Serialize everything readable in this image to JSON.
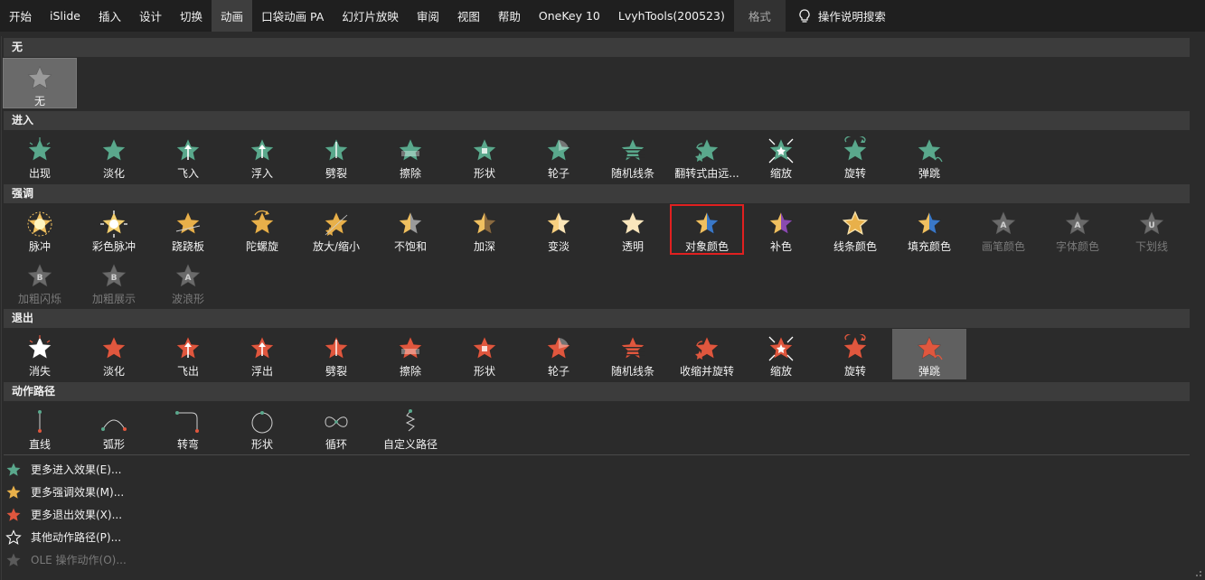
{
  "ribbon": {
    "tabs": [
      "开始",
      "iSlide",
      "插入",
      "设计",
      "切换",
      "动画",
      "口袋动画 PA",
      "幻灯片放映",
      "审阅",
      "视图",
      "帮助",
      "OneKey 10",
      "LvyhTools(200523)"
    ],
    "format_tab": "格式",
    "search_label": "操作说明搜索"
  },
  "sections": {
    "none": "无",
    "entrance": "进入",
    "emphasis": "强调",
    "exit": "退出",
    "motion": "动作路径"
  },
  "none_items": [
    "无"
  ],
  "entrance_items": [
    "出现",
    "淡化",
    "飞入",
    "浮入",
    "劈裂",
    "擦除",
    "形状",
    "轮子",
    "随机线条",
    "翻转式由远...",
    "缩放",
    "旋转",
    "弹跳"
  ],
  "emphasis_items": [
    "脉冲",
    "彩色脉冲",
    "跷跷板",
    "陀螺旋",
    "放大/缩小",
    "不饱和",
    "加深",
    "变淡",
    "透明",
    "对象颜色",
    "补色",
    "线条颜色",
    "填充颜色",
    "画笔颜色",
    "字体颜色",
    "下划线",
    "加粗闪烁",
    "加粗展示",
    "波浪形"
  ],
  "exit_items": [
    "消失",
    "淡化",
    "飞出",
    "浮出",
    "劈裂",
    "擦除",
    "形状",
    "轮子",
    "随机线条",
    "收缩并旋转",
    "缩放",
    "旋转",
    "弹跳"
  ],
  "motion_items": [
    "直线",
    "弧形",
    "转弯",
    "形状",
    "循环",
    "自定义路径"
  ],
  "more": [
    {
      "label": "更多进入效果(E)...",
      "color": "#5aa88c"
    },
    {
      "label": "更多强调效果(M)...",
      "color": "#e8b04a"
    },
    {
      "label": "更多退出效果(X)...",
      "color": "#e0573e"
    },
    {
      "label": "其他动作路径(P)...",
      "color": "#ffffff"
    },
    {
      "label": "OLE 操作动作(O)...",
      "color": "#6e6e6e"
    }
  ],
  "colors": {
    "entrance": "#5aa88c",
    "emphasis": "#e8b04a",
    "exit": "#e0573e",
    "highlight_border": "#e02020"
  }
}
